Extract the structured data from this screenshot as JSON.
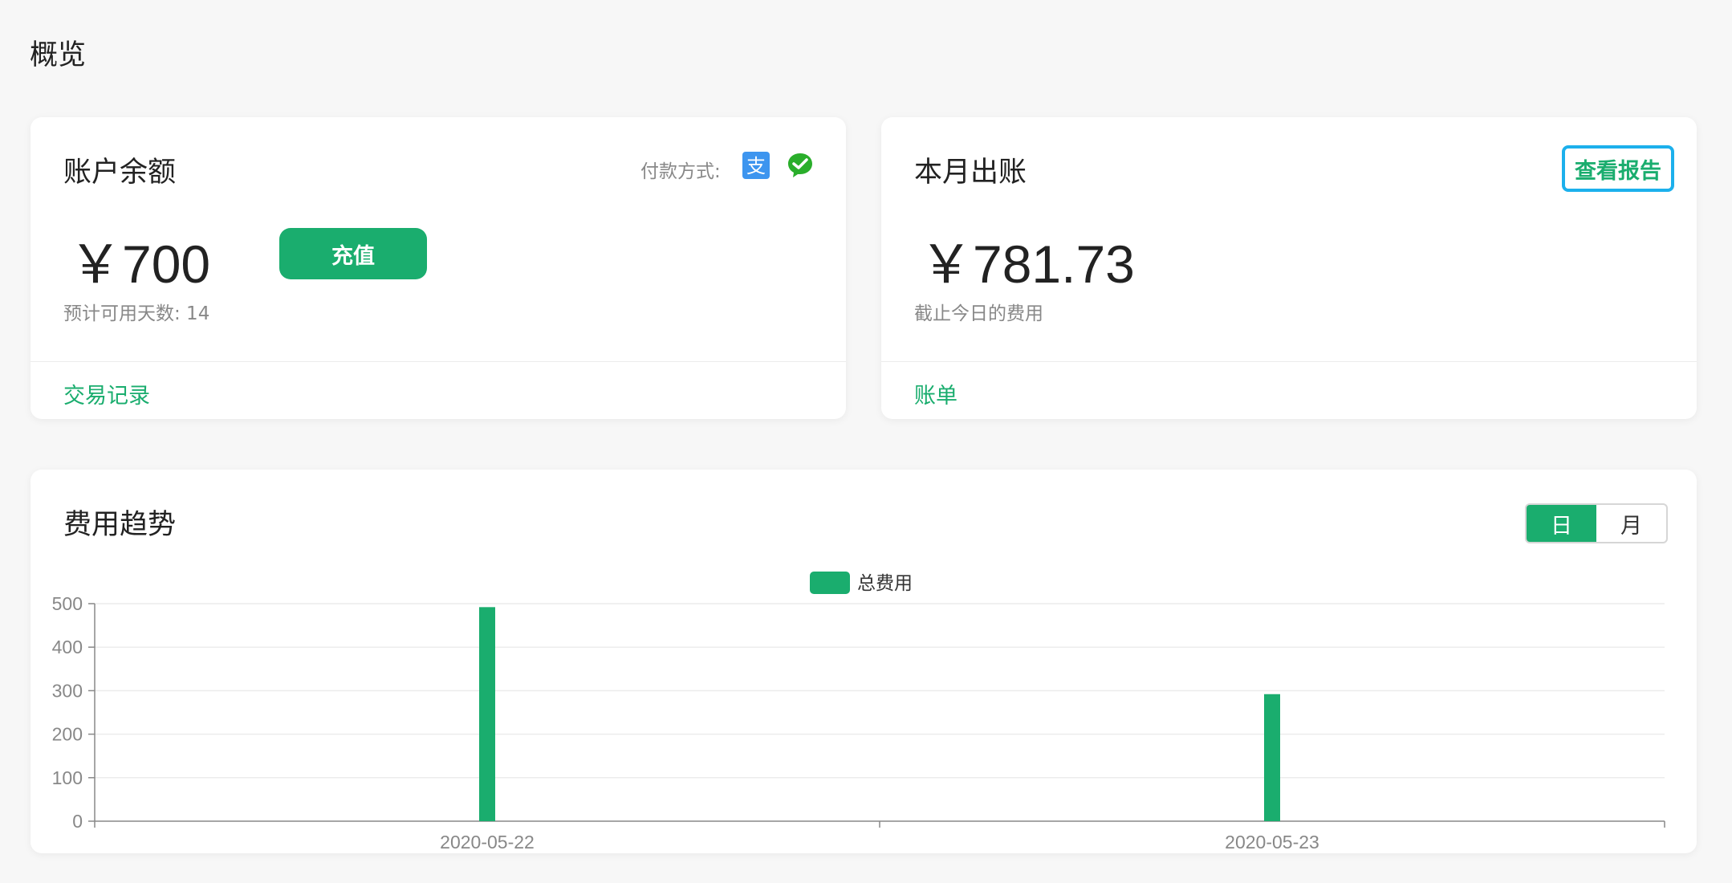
{
  "page": {
    "title": "概览"
  },
  "balance": {
    "title": "账户余额",
    "pay_label": "付款方式:",
    "amount": "￥700",
    "recharge_label": "充值",
    "days_text": "预计可用天数: 14",
    "footer_link": "交易记录",
    "icons": [
      "alipay-icon",
      "wechat-pay-icon"
    ]
  },
  "bill": {
    "title": "本月出账",
    "report_label": "查看报告",
    "amount": "￥781.73",
    "sub_text": "截止今日的费用",
    "footer_link": "账单"
  },
  "trend": {
    "title": "费用趋势",
    "toggle": {
      "day": "日",
      "month": "月",
      "active": "日"
    }
  },
  "colors": {
    "accent": "#1aad6e",
    "focus_outline": "#1cb0ec",
    "alipay": "#3d95ef"
  },
  "chart_data": {
    "type": "bar",
    "categories": [
      "2020-05-22",
      "2020-05-23"
    ],
    "series": [
      {
        "name": "总费用",
        "values": [
          492,
          292
        ]
      }
    ],
    "ylim": [
      0,
      500
    ],
    "yticks": [
      0,
      100,
      200,
      300,
      400,
      500
    ],
    "legend": "top-center",
    "grid": true
  }
}
